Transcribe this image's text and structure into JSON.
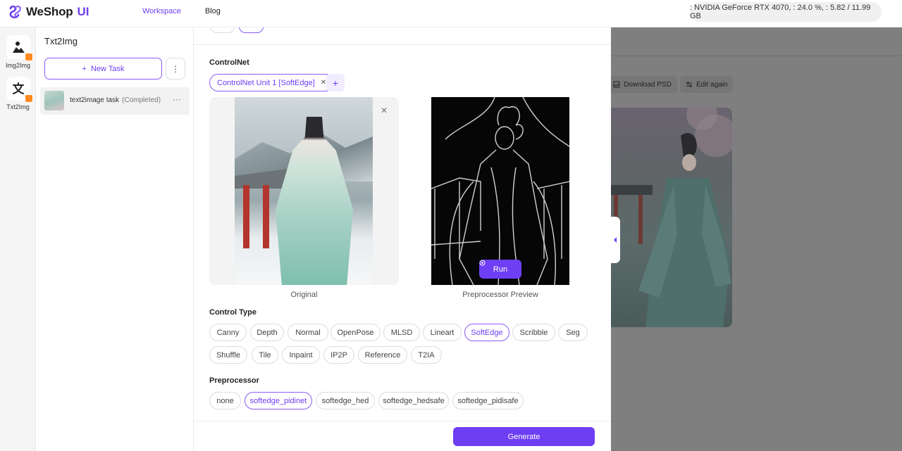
{
  "header": {
    "logo_text": "WeShop",
    "logo_suffix": "UI",
    "nav": [
      {
        "label": "Workspace",
        "active": true
      },
      {
        "label": "Blog",
        "active": false
      }
    ],
    "gpu_status": ": NVIDIA GeForce RTX 4070, : 24.0 %, : 5.82 / 11.99 GB"
  },
  "rail": {
    "items": [
      {
        "label": "Img2Img",
        "icon": "person-photo-icon"
      },
      {
        "label": "Txt2Img",
        "icon": "translate-icon"
      }
    ]
  },
  "tasks": {
    "title": "Txt2Img",
    "new_task_label": "New Task",
    "new_task_plus": "+",
    "more_glyph": "⋮",
    "list": [
      {
        "name": "text2image task",
        "status": "(Completed)",
        "more_glyph": "···"
      }
    ]
  },
  "result": {
    "download_psd_label": "Download PSD",
    "edit_again_label": "Edit again"
  },
  "controlnet": {
    "title": "ControlNet",
    "unit_label": "ControlNet Unit 1 [SoftEdge]",
    "unit_close": "✕",
    "add_glyph": "+",
    "close_glyph": "✕",
    "original_caption": "Original",
    "preview_caption": "Preprocessor Preview",
    "run_label": "Run",
    "control_type_title": "Control Type",
    "control_types_row1": [
      "Canny",
      "Depth",
      "Normal",
      "OpenPose",
      "MLSD",
      "Lineart",
      "SoftEdge",
      "Scribble",
      "Seg"
    ],
    "control_types_row2": [
      "Shuffle",
      "Tile",
      "Inpaint",
      "IP2P",
      "Reference",
      "T2IA"
    ],
    "selected_control_type": "SoftEdge",
    "preprocessor_title": "Preprocessor",
    "preprocessors": [
      "none",
      "softedge_pidinet",
      "softedge_hed",
      "softedge_hedsafe",
      "softedge_pidisafe"
    ],
    "selected_preprocessor": "softedge_pidinet"
  },
  "generate_label": "Generate",
  "colors": {
    "accent": "#6e3ef4",
    "badge": "#ff8a1f"
  }
}
